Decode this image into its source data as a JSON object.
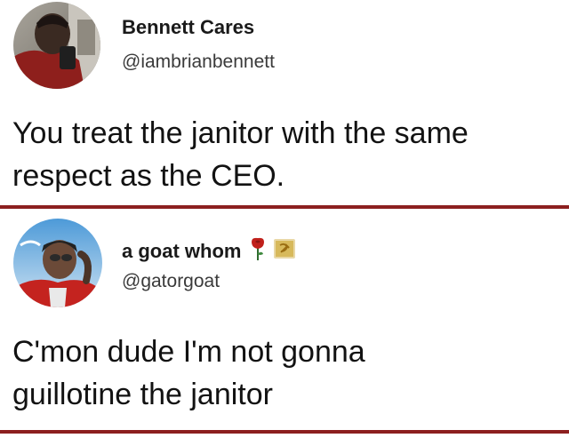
{
  "tweets": [
    {
      "display_name": "Bennett Cares",
      "handle": "@iambrianbennett",
      "text_lines": [
        "You treat the janitor with the same",
        "respect as the CEO."
      ]
    },
    {
      "display_name": "a goat whom",
      "handle": "@gatorgoat",
      "badges": [
        "rose-emoji-icon",
        "hammer-and-sickle-flag-icon"
      ],
      "text_lines": [
        "C'mon dude I'm not gonna",
        "guillotine the janitor"
      ]
    }
  ],
  "colors": {
    "divider": "#8c1f1f",
    "text": "#141414",
    "handle": "#3a3a3a"
  }
}
